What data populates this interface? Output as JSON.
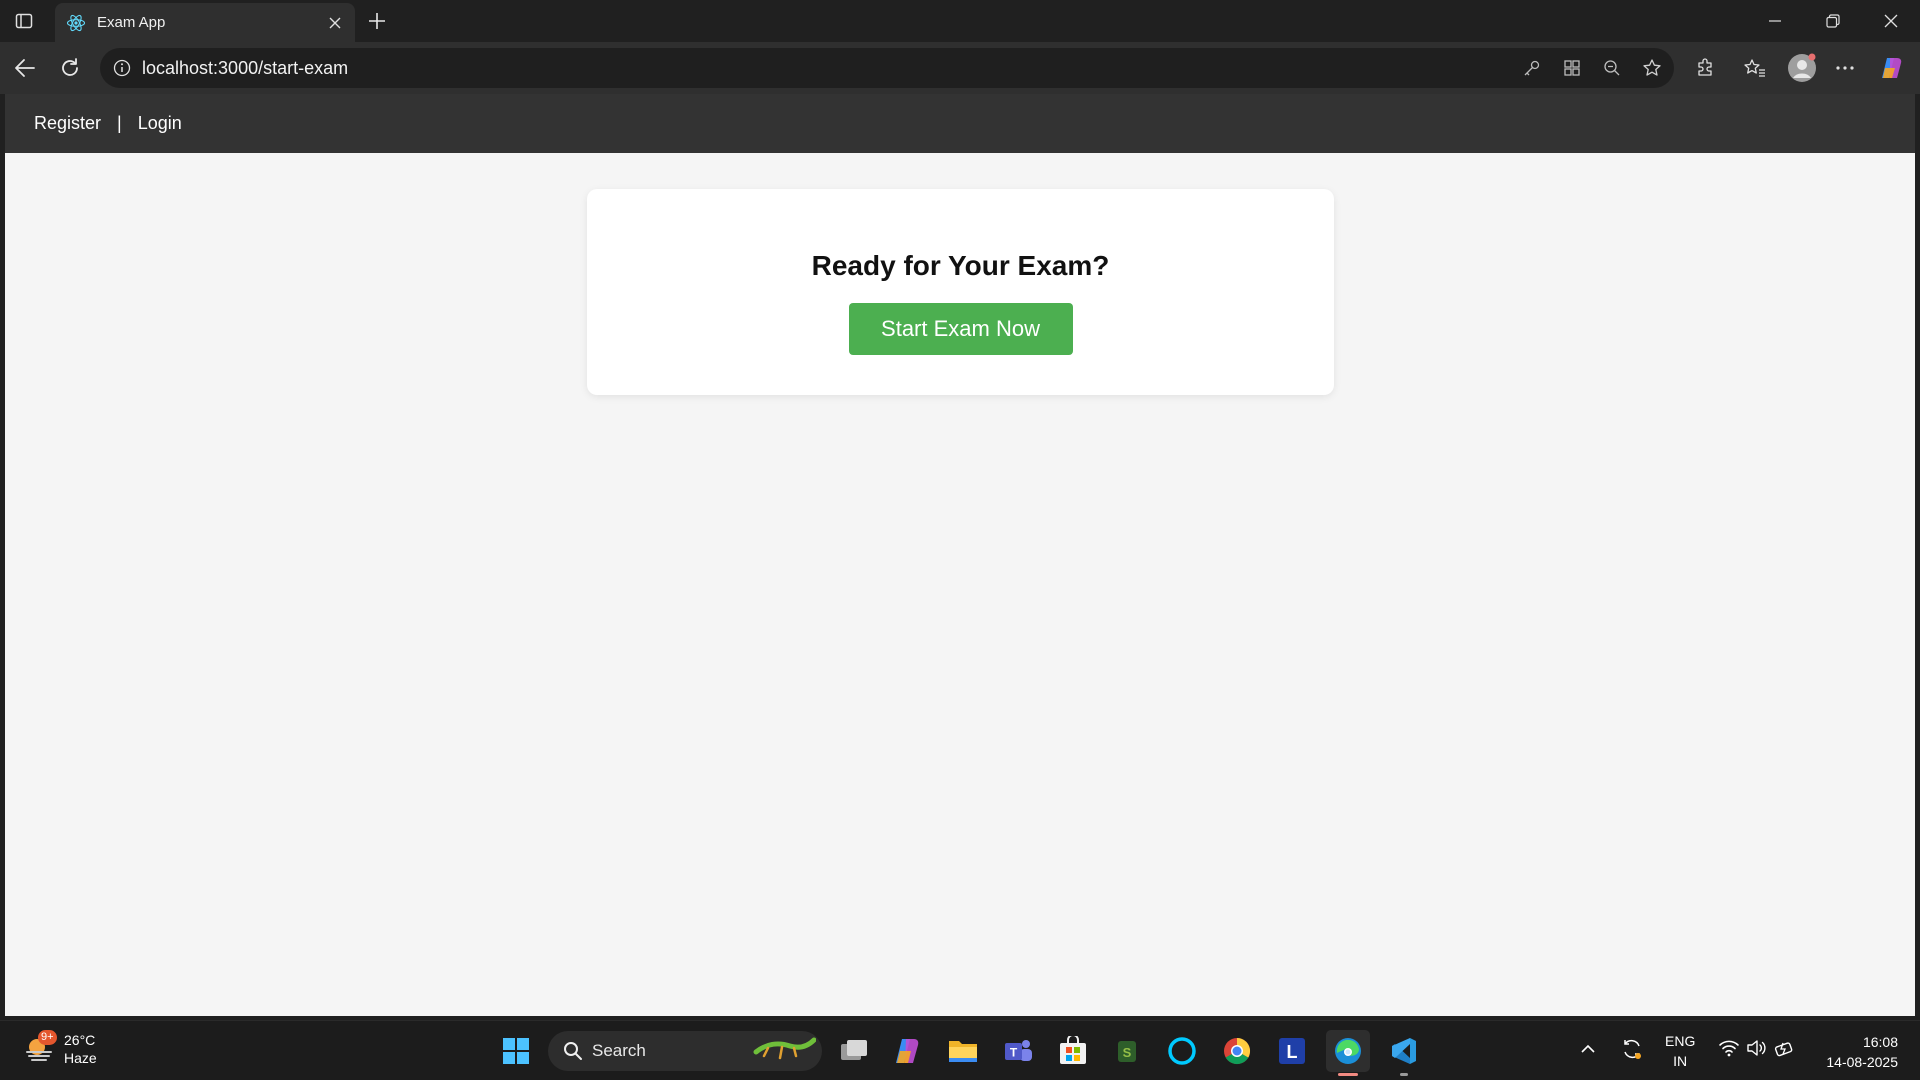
{
  "browser": {
    "tab_title": "Exam App",
    "url": "localhost:3000/start-exam"
  },
  "nav": {
    "register": "Register",
    "separator": "|",
    "login": "Login"
  },
  "main": {
    "heading": "Ready for Your Exam?",
    "start_button": "Start Exam Now"
  },
  "taskbar": {
    "weather": {
      "temp": "26°C",
      "condition": "Haze",
      "badge": "9+"
    },
    "search_label": "Search",
    "language": {
      "lang": "ENG",
      "region": "IN"
    },
    "time": "16:08",
    "date": "14-08-2025"
  },
  "colors": {
    "accent_button": "#4caf50",
    "navbar": "#333333",
    "page_bg": "#f5f5f5"
  }
}
